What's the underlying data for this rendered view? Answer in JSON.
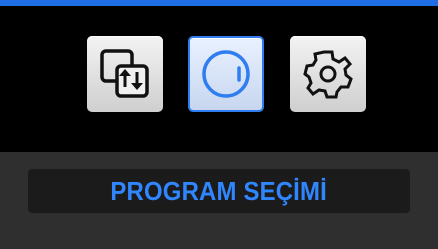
{
  "header": {
    "accent_color": "#1f6ee6"
  },
  "menu": {
    "items": [
      {
        "icon": "copy-icon",
        "selected": false
      },
      {
        "icon": "program-dial-icon",
        "selected": true
      },
      {
        "icon": "settings-gear-icon",
        "selected": false
      }
    ],
    "selected_color": "#2f7df0"
  },
  "footer": {
    "label": "PROGRAM SEÇİMİ",
    "label_color": "#2f86ff"
  }
}
